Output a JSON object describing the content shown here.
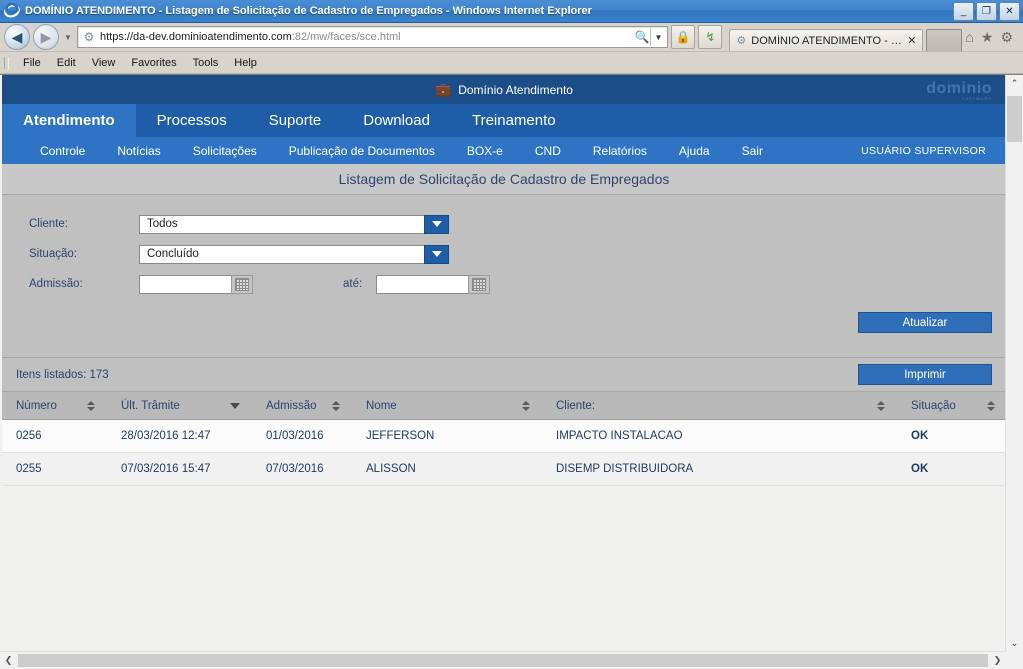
{
  "browser": {
    "window_title": "DOMÍNIO ATENDIMENTO - Listagem de Solicitação de Cadastro de Empregados - Windows Internet Explorer",
    "window_buttons": {
      "minimize": "_",
      "maximize": "❐",
      "close": "✕"
    },
    "back_glyph": "◀",
    "forward_glyph": "▶",
    "recent_glyph": "▼",
    "url_scheme": "https://da-dev.dominioatendimento.com",
    "url_path": ":82/mw/faces/sce.html",
    "search_glyph": "🔍",
    "lock_glyph": "🔒",
    "refresh_glyph": "↯",
    "tab_label": "DOMÍNIO ATENDIMENTO - Li...",
    "tab_close": "✕",
    "tool_home": "⌂",
    "tool_favorites": "★",
    "tool_settings": "⚙",
    "menu": [
      "File",
      "Edit",
      "View",
      "Favorites",
      "Tools",
      "Help"
    ]
  },
  "app": {
    "brand_text": "Domínio Atendimento",
    "brand_icon": "briefcase-icon",
    "logo_text": "dominio",
    "logo_sub": "SOFTWARE",
    "user_label": "USUÁRIO SUPERVISOR",
    "nav_tabs": [
      {
        "label": "Atendimento",
        "active": true
      },
      {
        "label": "Processos",
        "active": false
      },
      {
        "label": "Suporte",
        "active": false
      },
      {
        "label": "Download",
        "active": false
      },
      {
        "label": "Treinamento",
        "active": false
      }
    ],
    "sub_nav": [
      "Controle",
      "Notícias",
      "Solicitações",
      "Publicação de Documentos",
      "BOX-e",
      "CND",
      "Relatórios",
      "Ajuda",
      "Sair"
    ]
  },
  "page": {
    "title": "Listagem de Solicitação de Cadastro de Empregados"
  },
  "filters": {
    "cliente_label": "Cliente:",
    "cliente_value": "Todos",
    "situacao_label": "Situação:",
    "situacao_value": "Concluído",
    "admissao_label": "Admissão:",
    "admissao_from": "",
    "ate_label": "até:",
    "admissao_to": "",
    "atualizar_label": "Atualizar",
    "calendar_icon": "calendar-icon"
  },
  "list": {
    "count_label": "Itens listados: 173",
    "imprimir_label": "Imprimir",
    "columns": [
      {
        "label": "Número",
        "sort": "both"
      },
      {
        "label": "Últ. Trâmite",
        "sort": "desc"
      },
      {
        "label": "Admissão",
        "sort": "both"
      },
      {
        "label": "Nome",
        "sort": "both"
      },
      {
        "label": "Cliente:",
        "sort": "both"
      },
      {
        "label": "Situação",
        "sort": "both"
      }
    ],
    "rows": [
      {
        "numero": "0256",
        "ult_tramite": "28/03/2016 12:47",
        "admissao": "01/03/2016",
        "nome": "JEFFERSON",
        "cliente": "IMPACTO INSTALACAO",
        "situacao": "OK"
      },
      {
        "numero": "0255",
        "ult_tramite": "07/03/2016 15:47",
        "admissao": "07/03/2016",
        "nome": "ALISSON",
        "cliente": "DISEMP DISTRIBUIDORA",
        "situacao": "OK"
      }
    ]
  },
  "scrollbars": {
    "up_glyph": "⌃",
    "down_glyph": "⌄",
    "left_glyph": "❮",
    "right_glyph": "❯"
  },
  "colors": {
    "accent_blue": "#1f5da8",
    "nav_blue": "#2f74c4",
    "header_blue": "#1c4d87",
    "text_blue": "#2b4570",
    "panel_grey": "#c0c0c0"
  }
}
